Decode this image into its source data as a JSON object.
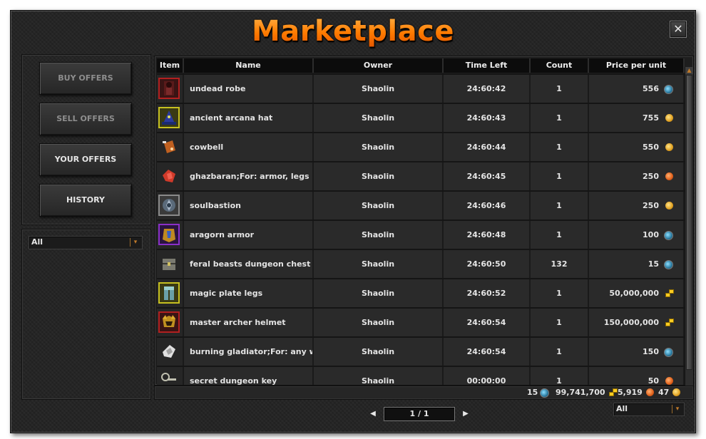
{
  "window": {
    "title": "Marketplace",
    "close_label": "✕"
  },
  "nav": {
    "buy_offers": "BUY OFFERS",
    "sell_offers": "SELL OFFERS",
    "your_offers": "YOUR OFFERS",
    "history": "HISTORY"
  },
  "category_filter": {
    "selected": "All"
  },
  "table": {
    "headers": [
      "Item",
      "Name",
      "Owner",
      "Time Left",
      "Count",
      "Price per unit"
    ],
    "rows": [
      {
        "icon": "undead-robe-icon",
        "frame": "red",
        "name": "undead robe",
        "owner": "Shaolin",
        "time_left": "24:60:42",
        "count": "1",
        "price": "556",
        "currency": "blue-coin"
      },
      {
        "icon": "ancient-arcana-hat-icon",
        "frame": "yellow",
        "name": "ancient arcana hat",
        "owner": "Shaolin",
        "time_left": "24:60:43",
        "count": "1",
        "price": "755",
        "currency": "gold-coin"
      },
      {
        "icon": "cowbell-icon",
        "frame": "none",
        "name": "cowbell",
        "owner": "Shaolin",
        "time_left": "24:60:44",
        "count": "1",
        "price": "550",
        "currency": "gold-coin"
      },
      {
        "icon": "ghazbaran-icon",
        "frame": "none",
        "name": "ghazbaran;For: armor, legs",
        "owner": "Shaolin",
        "time_left": "24:60:45",
        "count": "1",
        "price": "250",
        "currency": "orange-coin"
      },
      {
        "icon": "soulbastion-icon",
        "frame": "grey",
        "name": "soulbastion",
        "owner": "Shaolin",
        "time_left": "24:60:46",
        "count": "1",
        "price": "250",
        "currency": "gold-coin"
      },
      {
        "icon": "aragorn-armor-icon",
        "frame": "purple",
        "name": "aragorn armor",
        "owner": "Shaolin",
        "time_left": "24:60:48",
        "count": "1",
        "price": "100",
        "currency": "blue-coin"
      },
      {
        "icon": "dungeon-chest-icon",
        "frame": "none",
        "name": "feral beasts dungeon chest",
        "owner": "Shaolin",
        "time_left": "24:60:50",
        "count": "132",
        "price": "15",
        "currency": "blue-coin"
      },
      {
        "icon": "magic-plate-legs-icon",
        "frame": "yellow",
        "name": "magic plate legs",
        "owner": "Shaolin",
        "time_left": "24:60:52",
        "count": "1",
        "price": "50,000,000",
        "currency": "gold-bars"
      },
      {
        "icon": "master-archer-helmet-icon",
        "frame": "red",
        "name": "master archer helmet",
        "owner": "Shaolin",
        "time_left": "24:60:54",
        "count": "1",
        "price": "150,000,000",
        "currency": "gold-bars"
      },
      {
        "icon": "burning-gladiator-icon",
        "frame": "none",
        "name": "burning gladiator;For: any we",
        "owner": "Shaolin",
        "time_left": "24:60:54",
        "count": "1",
        "price": "150",
        "currency": "blue-coin"
      },
      {
        "icon": "secret-dungeon-key-icon",
        "frame": "none",
        "name": "secret dungeon key",
        "owner": "Shaolin",
        "time_left": "00:00:00",
        "count": "1",
        "price": "50",
        "currency": "orange-coin"
      }
    ]
  },
  "balance": [
    {
      "amount": "15",
      "currency": "blue-coin"
    },
    {
      "amount": "99,741,700",
      "currency": "gold-bars"
    },
    {
      "amount": "5,919",
      "currency": "orange-coin"
    },
    {
      "amount": "47",
      "currency": "gold-coin"
    }
  ],
  "pager": {
    "label": "1 / 1",
    "prev_icon": "arrow-left-icon",
    "next_icon": "arrow-right-icon"
  },
  "bottom_filter": {
    "selected": "All"
  },
  "colors": {
    "title_orange": "#ff8a1c",
    "frame_red": "#b22020",
    "frame_yellow": "#c6c020",
    "frame_purple": "#8a30c8"
  }
}
